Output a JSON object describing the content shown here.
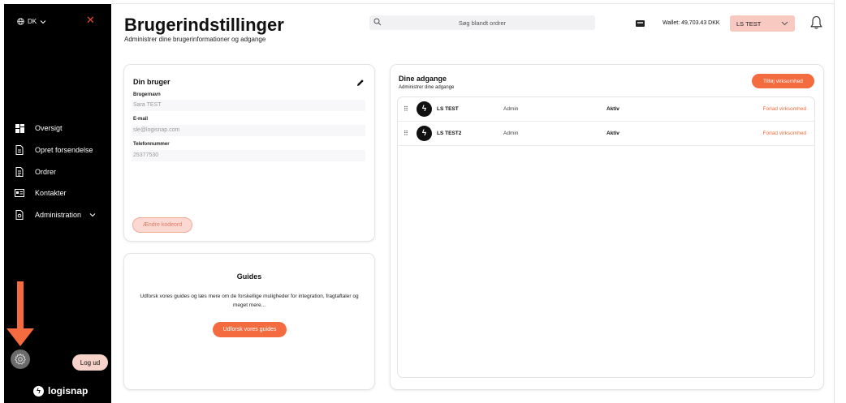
{
  "sidebar": {
    "language": "DK",
    "nav": [
      {
        "label": "Oversigt",
        "icon": "dashboard-icon"
      },
      {
        "label": "Opret forsendelse",
        "icon": "create-shipment-icon"
      },
      {
        "label": "Ordrer",
        "icon": "orders-icon"
      },
      {
        "label": "Kontakter",
        "icon": "contacts-icon"
      },
      {
        "label": "Administration",
        "icon": "administration-icon"
      }
    ],
    "logout_label": "Log ud",
    "logo_text": "logisnap"
  },
  "header": {
    "title": "Brugerindstillinger",
    "subtitle": "Administrer dine brugerinformationer og adgange",
    "search_placeholder": "Søg blandt ordrer",
    "wallet": "Wallet: 49,703.43 DKK",
    "company": "LS TEST"
  },
  "user_card": {
    "title": "Din bruger",
    "fields": [
      {
        "label": "Brugernavn",
        "value": "Sara TEST"
      },
      {
        "label": "E-mail",
        "value": "sle@logisnap.com"
      },
      {
        "label": "Telefonnummer",
        "value": "25377530"
      }
    ],
    "change_password": "Ændre kodeord"
  },
  "guides_card": {
    "title": "Guides",
    "text": "Udforsk vores guides og læs mere om de forskellige muligheder for integration, fragtaftaler og meget mere...",
    "button": "Udforsk vores guides"
  },
  "access_card": {
    "title": "Dine adgange",
    "subtitle": "Administrer dine adgange",
    "add_button": "Tilføj virksomhed",
    "rows": [
      {
        "name": "LS TEST",
        "role": "Admin",
        "status": "Aktiv",
        "action": "Forlad virksomhed"
      },
      {
        "name": "LS TEST2",
        "role": "Admin",
        "status": "Aktiv",
        "action": "Forlad virksomhed"
      }
    ]
  },
  "colors": {
    "accent": "#f36b3f",
    "sidebar": "#000000",
    "close": "#e94b2c"
  }
}
